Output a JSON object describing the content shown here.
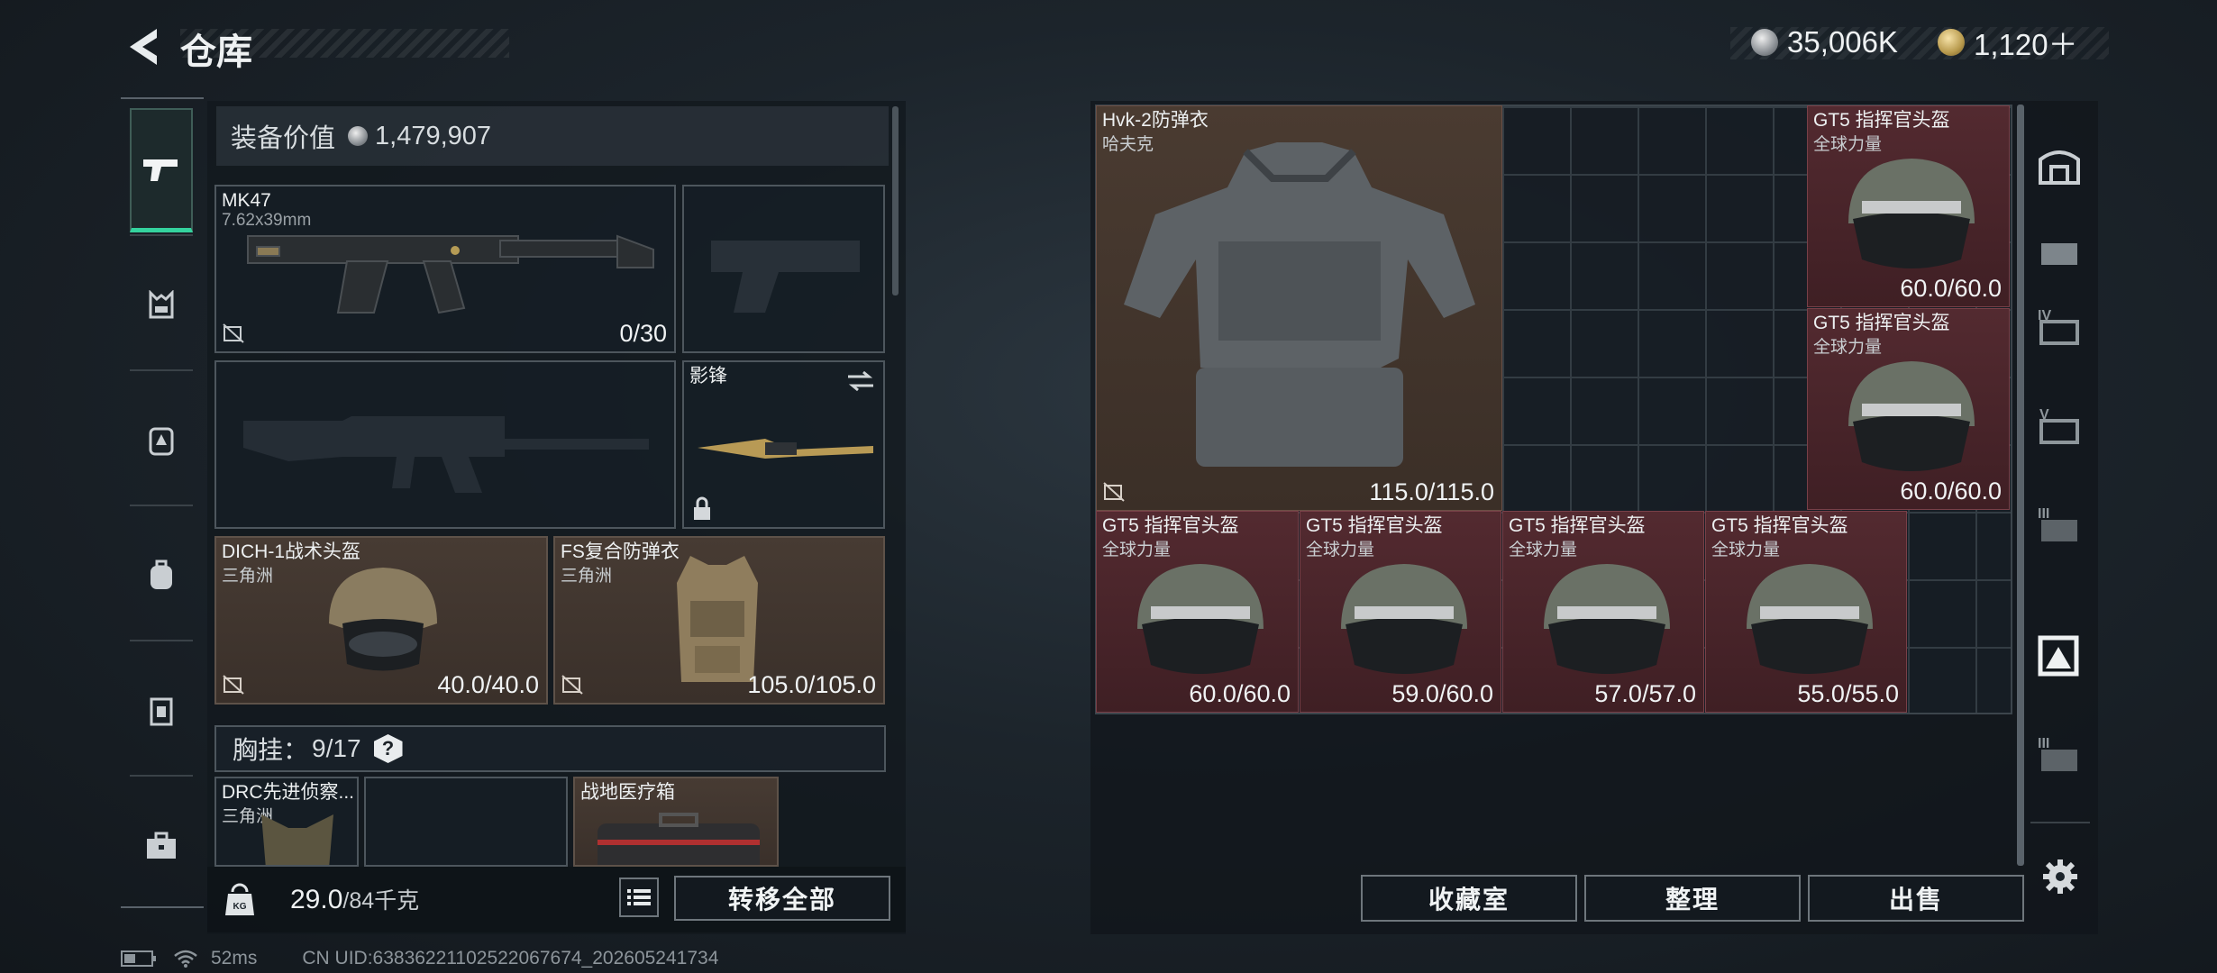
{
  "header": {
    "title": "仓库",
    "currency_silver": "35,006K",
    "currency_gold": "1,120＋"
  },
  "equipment": {
    "value_label": "装备价值",
    "value": "1,479,907",
    "primary": {
      "name": "MK47",
      "sub": "7.62x39mm",
      "ammo": "0/30"
    },
    "melee": {
      "name": "影锋"
    },
    "helmet": {
      "name": "DICH-1战术头盔",
      "sub": "三角洲",
      "durability": "40.0/40.0"
    },
    "armor": {
      "name": "FS复合防弹衣",
      "sub": "三角洲",
      "durability": "105.0/105.0"
    },
    "rig": {
      "label": "胸挂：",
      "capacity": "9/17",
      "help": "?"
    },
    "rig_items": [
      {
        "name": "DRC先进侦察...",
        "sub": "三角洲"
      },
      {
        "name": "战地医疗箱",
        "sub": ""
      }
    ]
  },
  "weight": {
    "current": "29.0",
    "max": "/84千克"
  },
  "buttons": {
    "transfer_all": "转移全部",
    "collection": "收藏室",
    "organize": "整理",
    "sell": "出售"
  },
  "storage_items": [
    {
      "name": "Hvk-2防弹衣",
      "sub": "哈夫克",
      "value": "115.0/115.0"
    },
    {
      "name": "GT5 指挥官头盔",
      "sub": "全球力量",
      "value": "60.0/60.0"
    },
    {
      "name": "GT5 指挥官头盔",
      "sub": "全球力量",
      "value": "60.0/60.0"
    },
    {
      "name": "GT5 指挥官头盔",
      "sub": "全球力量",
      "value": "60.0/60.0"
    },
    {
      "name": "GT5 指挥官头盔",
      "sub": "全球力量",
      "value": "59.0/60.0"
    },
    {
      "name": "GT5 指挥官头盔",
      "sub": "全球力量",
      "value": "57.0/57.0"
    },
    {
      "name": "GT5 指挥官头盔",
      "sub": "全球力量",
      "value": "55.0/55.0"
    }
  ],
  "status": {
    "ping": "52ms",
    "uid": "CN UID:6383622110252206767​4_202605241734"
  }
}
